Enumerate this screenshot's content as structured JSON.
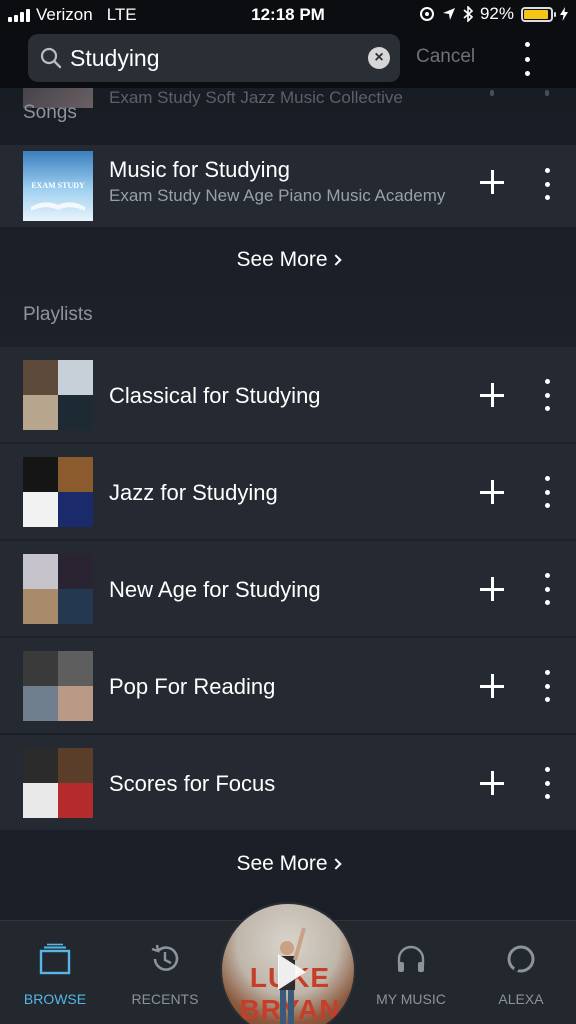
{
  "status_bar": {
    "carrier": "Verizon",
    "network": "LTE",
    "time": "12:18 PM",
    "battery": "92%",
    "battery_level": 0.92,
    "icons": [
      "signal-icon",
      "location-lock-icon",
      "location-arrow-icon",
      "bluetooth-icon",
      "battery-icon",
      "charging-icon"
    ]
  },
  "search": {
    "query": "Studying",
    "cancel_label": "Cancel",
    "icons": [
      "search-icon",
      "clear-icon",
      "overflow-menu-icon"
    ]
  },
  "songs_section": {
    "label": "Songs",
    "peek_item": {
      "subtitle": "Exam Study Soft Jazz Music Collective"
    },
    "items": [
      {
        "title": "Music for Studying",
        "subtitle": "Exam Study New Age Piano Music Academy",
        "art_text": "EXAM STUDY"
      }
    ],
    "see_more_label": "See More"
  },
  "playlists_section": {
    "label": "Playlists",
    "items": [
      {
        "title": "Classical for Studying",
        "art_colors": [
          "#5d4a3a",
          "#c7cfd8",
          "#b7a58e",
          "#1e2a33"
        ]
      },
      {
        "title": "Jazz for Studying",
        "art_colors": [
          "#151515",
          "#8b5b2e",
          "#f2f2f2",
          "#1b2a6a"
        ]
      },
      {
        "title": "New Age for Studying",
        "art_colors": [
          "#c7c3cc",
          "#2a2331",
          "#a88b6b",
          "#24394f"
        ]
      },
      {
        "title": "Pop For Reading",
        "art_colors": [
          "#3a3a3a",
          "#5e5e5e",
          "#6f7f8e",
          "#b89a86"
        ]
      },
      {
        "title": "Scores for Focus",
        "art_colors": [
          "#2b2b2b",
          "#5a3e2a",
          "#e9e9e9",
          "#b52a2a"
        ]
      }
    ],
    "see_more_label": "See More"
  },
  "tab_bar": {
    "tabs": [
      {
        "label": "BROWSE",
        "icon": "browse-icon",
        "active": true
      },
      {
        "label": "RECENTS",
        "icon": "recents-icon",
        "active": false
      },
      {
        "label": "MY MUSIC",
        "icon": "headphones-icon",
        "active": false
      },
      {
        "label": "ALEXA",
        "icon": "alexa-icon",
        "active": false
      }
    ],
    "now_playing": {
      "art_text": "LUKE BRYAN",
      "icon": "play-icon"
    }
  },
  "colors": {
    "accent": "#56b7e6",
    "background": "#1d222b",
    "row_background": "#242932",
    "muted_text": "#8f949c",
    "battery_fill": "#f5c518"
  }
}
